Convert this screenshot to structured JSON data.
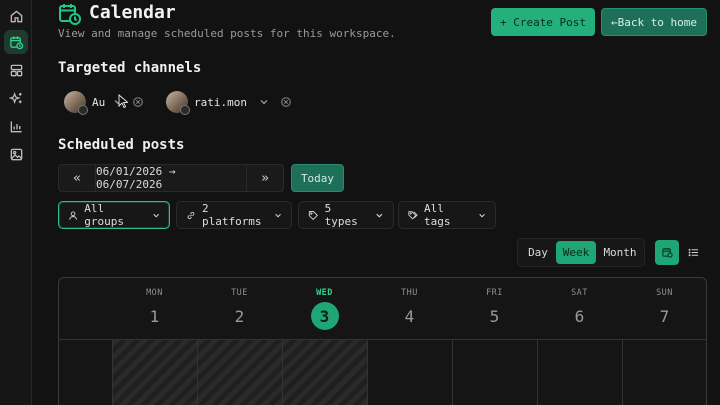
{
  "page": {
    "title": "Calendar",
    "subtitle": "View and manage scheduled posts for this workspace."
  },
  "header": {
    "create_label": "+ Create Post",
    "back_label": "←Back to home"
  },
  "sidebar": {
    "items": [
      {
        "name": "home",
        "icon": "home-icon",
        "active": false
      },
      {
        "name": "calendar",
        "icon": "calendar-clock-icon",
        "active": true
      },
      {
        "name": "layout",
        "icon": "layout-icon",
        "active": false
      },
      {
        "name": "sparkles",
        "icon": "sparkles-icon",
        "active": false
      },
      {
        "name": "analytics",
        "icon": "chart-icon",
        "active": false
      },
      {
        "name": "media",
        "icon": "image-icon",
        "active": false
      }
    ]
  },
  "channels": {
    "heading": "Targeted channels",
    "items": [
      {
        "label": "Au"
      },
      {
        "label": "rati.mon"
      }
    ]
  },
  "scheduled": {
    "heading": "Scheduled posts",
    "prev": "«",
    "next": "»",
    "range": "06/01/2026 → 06/07/2026",
    "today_label": "Today"
  },
  "filters": {
    "groups": "All groups",
    "platforms": "2 platforms",
    "types": "5 types",
    "tags": "All tags"
  },
  "views": {
    "day": "Day",
    "week": "Week",
    "month": "Month",
    "active": "Week"
  },
  "calendar": {
    "days": [
      {
        "dow": "MON",
        "num": "1",
        "today": false
      },
      {
        "dow": "TUE",
        "num": "2",
        "today": false
      },
      {
        "dow": "WED",
        "num": "3",
        "today": true
      },
      {
        "dow": "THU",
        "num": "4",
        "today": false
      },
      {
        "dow": "FRI",
        "num": "5",
        "today": false
      },
      {
        "dow": "SAT",
        "num": "6",
        "today": false
      },
      {
        "dow": "SUN",
        "num": "7",
        "today": false
      }
    ]
  },
  "colors": {
    "accent": "#23b07d",
    "background": "#121212",
    "today_text": "#2fd48f"
  }
}
